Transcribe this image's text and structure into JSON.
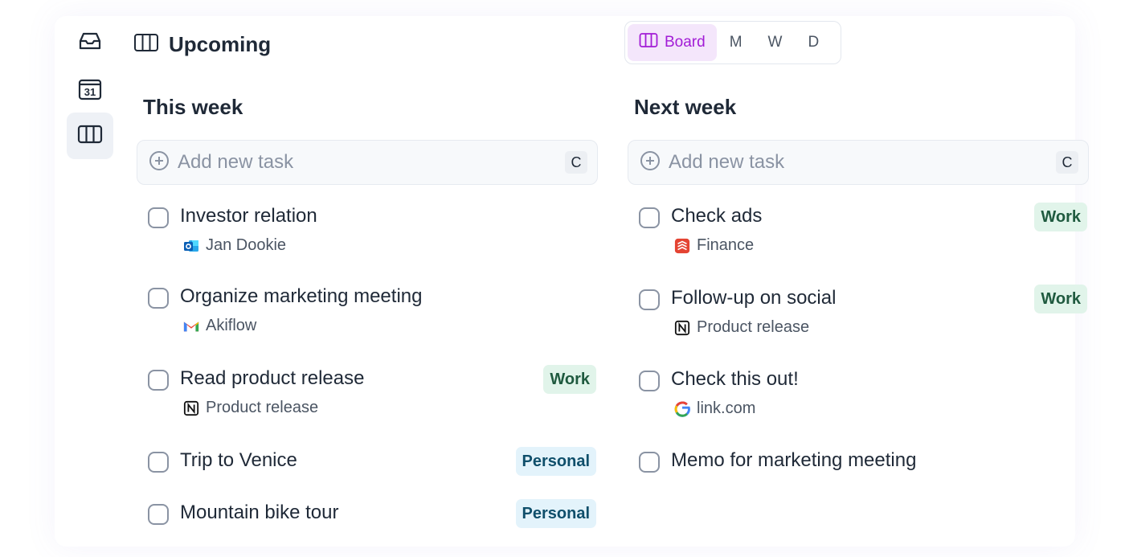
{
  "header": {
    "title": "Upcoming",
    "views": [
      {
        "label": "Board",
        "active": true
      },
      {
        "label": "M"
      },
      {
        "label": "W"
      },
      {
        "label": "D"
      }
    ]
  },
  "sidebar": {
    "items": [
      {
        "icon": "inbox-icon"
      },
      {
        "icon": "calendar-icon",
        "label": "31"
      },
      {
        "icon": "board-icon",
        "active": true
      }
    ]
  },
  "columns": [
    {
      "title": "This week",
      "add_placeholder": "Add new task",
      "shortcut": "C",
      "tasks": [
        {
          "title": "Investor relation",
          "source": "Jan Dookie",
          "source_icon": "outlook-icon",
          "tag": ""
        },
        {
          "title": "Organize marketing meeting",
          "source": "Akiflow",
          "source_icon": "gmail-icon",
          "tag": ""
        },
        {
          "title": "Read product release",
          "source": "Product release",
          "source_icon": "notion-icon",
          "tag": "Work"
        },
        {
          "title": "Trip to Venice",
          "source": "",
          "tag": "Personal"
        },
        {
          "title": "Mountain bike tour",
          "source": "",
          "tag": "Personal"
        }
      ]
    },
    {
      "title": "Next week",
      "add_placeholder": "Add new task",
      "shortcut": "C",
      "tasks": [
        {
          "title": "Check ads",
          "source": "Finance",
          "source_icon": "todoist-icon",
          "tag": "Work"
        },
        {
          "title": "Follow-up on social",
          "source": "Product release",
          "source_icon": "notion-icon",
          "tag": "Work"
        },
        {
          "title": "Check this out!",
          "source": "link.com",
          "source_icon": "google-icon",
          "tag": ""
        },
        {
          "title": "Memo for marketing meeting",
          "source": "",
          "tag": ""
        }
      ]
    }
  ],
  "colors": {
    "accent": "#a21cd6",
    "accent_bg": "#f4e6fb",
    "work_tag_bg": "#e1f4ea",
    "personal_tag_bg": "#e3f3fb"
  }
}
